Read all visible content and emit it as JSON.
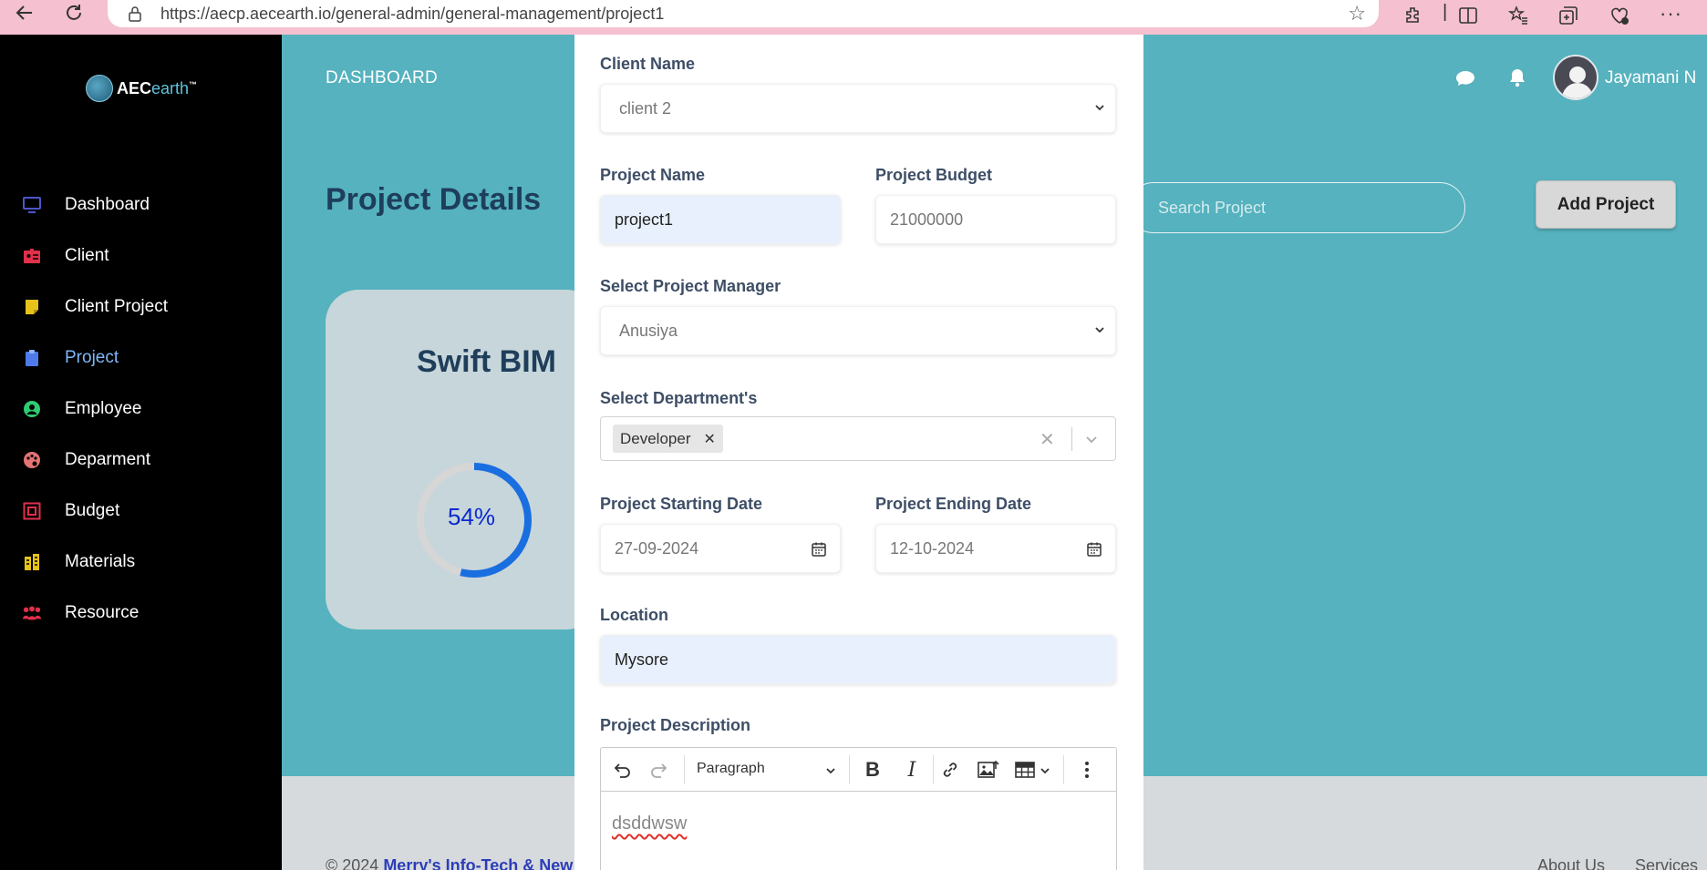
{
  "browser": {
    "url": "https://aecp.aecearth.io/general-admin/general-management/project1"
  },
  "brand": {
    "name_a": "AEC",
    "name_b": "earth",
    "tm": "™"
  },
  "sidebar": {
    "items": [
      {
        "label": "Dashboard",
        "icon": "monitor-icon",
        "color": "#4a57c9"
      },
      {
        "label": "Client",
        "icon": "id-card-icon",
        "color": "#e0304a"
      },
      {
        "label": "Client Project",
        "icon": "sticky-note-icon",
        "color": "#e6c21b"
      },
      {
        "label": "Project",
        "icon": "clipboard-icon",
        "color": "#4f7bea"
      },
      {
        "label": "Employee",
        "icon": "user-circle-icon",
        "color": "#2ecc71"
      },
      {
        "label": "Deparment",
        "icon": "palette-icon",
        "color": "#e57373"
      },
      {
        "label": "Budget",
        "icon": "budget-icon",
        "color": "#e0304a"
      },
      {
        "label": "Materials",
        "icon": "building-icon",
        "color": "#e6c21b"
      },
      {
        "label": "Resource",
        "icon": "people-icon",
        "color": "#e0304a"
      }
    ],
    "active": "Project"
  },
  "header": {
    "dashboard_link": "DASHBOARD",
    "user_name": "Jayamani N"
  },
  "page": {
    "title": "Project Details",
    "search_placeholder": "Search Project",
    "add_button": "Add Project"
  },
  "card": {
    "title": "Swift BIM",
    "progress": 54,
    "progress_label": "54%"
  },
  "form": {
    "client_name_label": "Client Name",
    "client_name_value": "client 2",
    "project_name_label": "Project Name",
    "project_name_value": "project1",
    "project_budget_label": "Project Budget",
    "project_budget_value": "21000000",
    "manager_label": "Select Project Manager",
    "manager_value": "Anusiya",
    "departments_label": "Select Department's",
    "departments_selected": [
      "Developer"
    ],
    "start_date_label": "Project Starting Date",
    "start_date_value": "27-09-2024",
    "end_date_label": "Project Ending Date",
    "end_date_value": "12-10-2024",
    "location_label": "Location",
    "location_value": "Mysore",
    "description_label": "Project Description",
    "editor_format": "Paragraph",
    "description_value": "dsddwsw"
  },
  "footer": {
    "copyright": "© 2024 ",
    "company": "Merry's Info-Tech & New",
    "about": "About Us",
    "services": "Services"
  },
  "colors": {
    "background": "#55b2be",
    "sidebar": "#000000",
    "active_menu": "#7fb8f7",
    "progress": "#1a6fe0"
  }
}
